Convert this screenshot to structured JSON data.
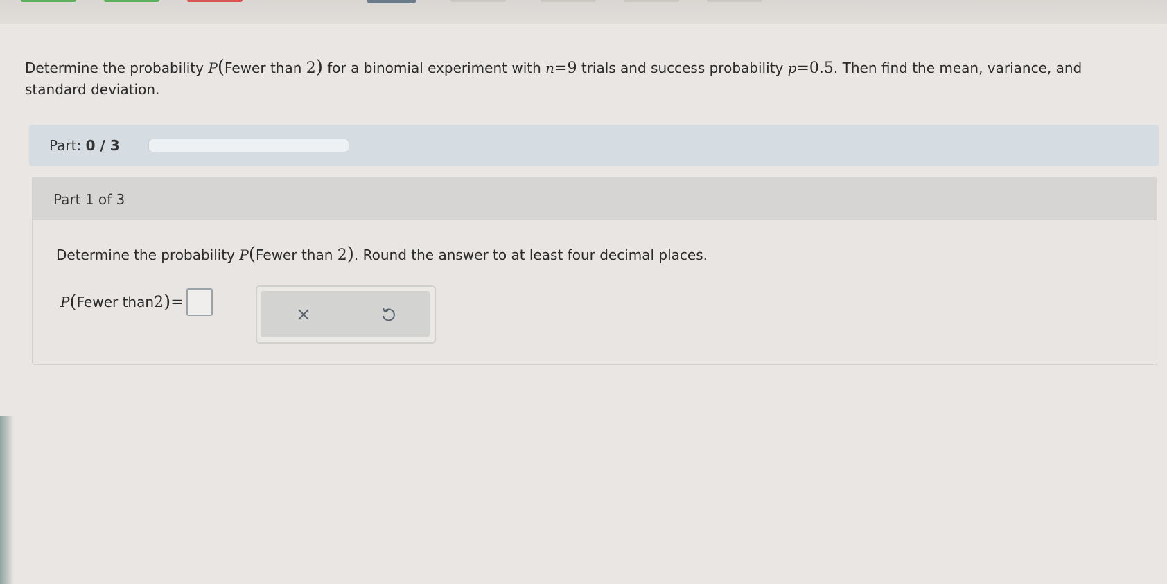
{
  "problem": {
    "lead": "Determine the probability ",
    "p_symbol": "P",
    "event": "Fewer than ",
    "event_num": "2",
    "middle": " for a binomial experiment with ",
    "n_symbol": "n",
    "n_eq": "=9",
    "middle2": " trials and success probability ",
    "p_small": "p",
    "p_eq": "=0.5",
    "tail": ". Then find the mean, variance, and standard deviation."
  },
  "progress": {
    "label": "Part: ",
    "value": "0 / 3",
    "fraction": 0
  },
  "part": {
    "header": "Part 1 of 3",
    "question_lead": "Determine the probability ",
    "question_p": "P",
    "question_event": "Fewer than ",
    "question_num": "2",
    "question_tail": ". Round the answer to at least four decimal places.",
    "answer_p": "P",
    "answer_event": "Fewer than ",
    "answer_num": "2",
    "answer_eq": "=",
    "answer_value": ""
  },
  "tools": {
    "clear_icon": "x-icon",
    "undo_icon": "undo-icon"
  }
}
